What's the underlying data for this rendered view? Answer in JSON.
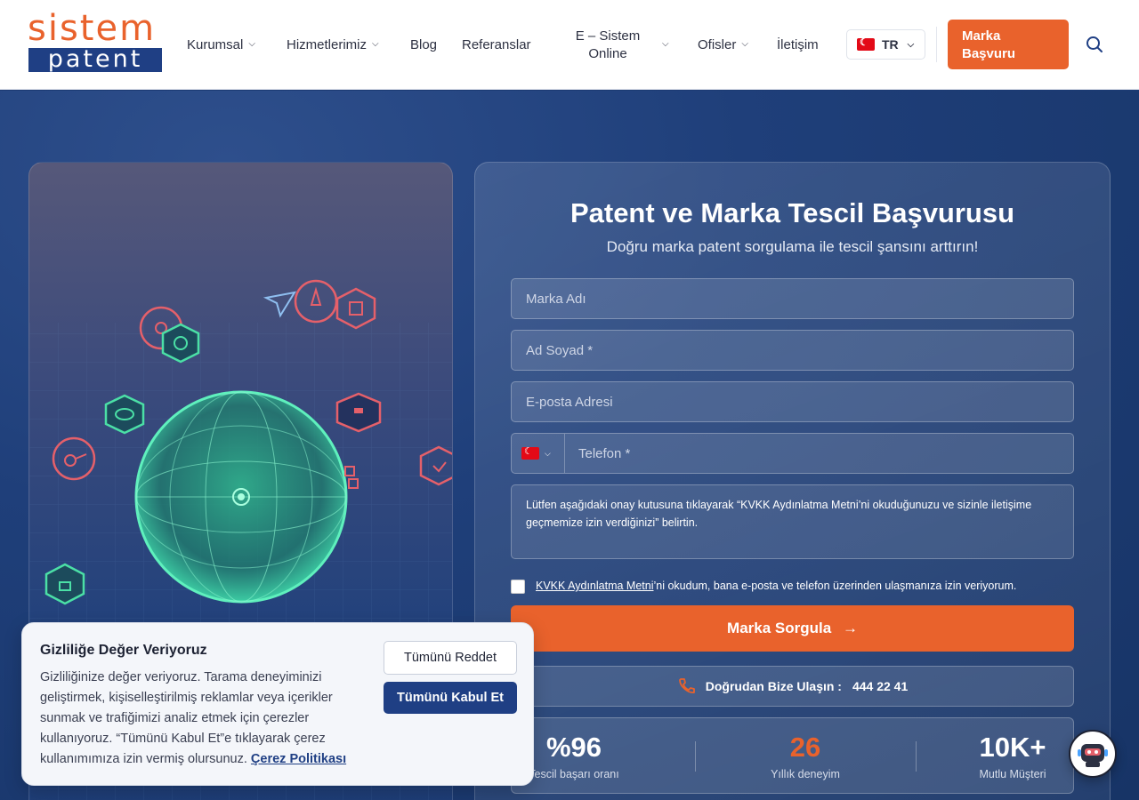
{
  "header": {
    "logo_top": "sistem",
    "logo_bottom": "patent",
    "nav": [
      {
        "label": "Kurumsal",
        "has_dropdown": true
      },
      {
        "label": "Hizmetlerimiz",
        "has_dropdown": true
      },
      {
        "label": "Blog",
        "has_dropdown": false
      },
      {
        "label": "Referanslar",
        "has_dropdown": false
      },
      {
        "label_line1": "E – Sistem",
        "label_line2": "Online",
        "has_dropdown": true
      },
      {
        "label": "Ofisler",
        "has_dropdown": true
      },
      {
        "label": "İletişim",
        "has_dropdown": false
      }
    ],
    "language": "TR",
    "cta_line1": "Marka",
    "cta_line2": "Başvuru",
    "search_icon": "search-icon"
  },
  "form": {
    "title": "Patent ve Marka Tescil Başvurusu",
    "subtitle": "Doğru marka patent sorgulama ile tescil şansını arttırın!",
    "brand_placeholder": "Marka Adı",
    "name_placeholder": "Ad Soyad *",
    "email_placeholder": "E-posta Adresi",
    "phone_placeholder": "Telefon *",
    "consent_text": "Lütfen aşağıdaki onay kutusuna tıklayarak “KVKK Aydınlatma Metni’ni okuduğunuzu ve sizinle iletişime geçmemize izin verdiğinizi” belirtin.",
    "checkbox_link": "KVKK Aydınlatma Metni",
    "checkbox_text": "’ni okudum, bana e-posta ve telefon üzerinden ulaşmanıza izin veriyorum.",
    "submit_label": "Marka Sorgula",
    "contact_label": "Doğrudan Bize Ulaşın :",
    "contact_number": "444 22 41"
  },
  "stats": [
    {
      "value": "%96",
      "label": "Tescil başarı oranı",
      "color": "#ffffff"
    },
    {
      "value": "26",
      "label": "Yıllık deneyim",
      "color": "#e9622c"
    },
    {
      "value": "10K+",
      "label": "Mutlu Müşteri",
      "color": "#ffffff"
    }
  ],
  "cookie": {
    "title": "Gizliliğe Değer Veriyoruz",
    "text": "Gizliliğinize değer veriyoruz. Tarama deneyiminizi geliştirmek, kişiselleştirilmiş reklamlar veya içerikler sunmak ve trafiğimizi analiz etmek için çerezler kullanıyoruz. “Tümünü Kabul Et”e tıklayarak çerez kullanımımıza izin vermiş olursunuz.",
    "policy_link": "Çerez Politikası",
    "reject_label": "Tümünü Reddet",
    "accept_label": "Tümünü Kabul Et"
  },
  "colors": {
    "accent": "#e9622c",
    "brand_blue": "#1f3f84",
    "hero_bg": "#1b3a73",
    "globe": "#3fdca8"
  }
}
